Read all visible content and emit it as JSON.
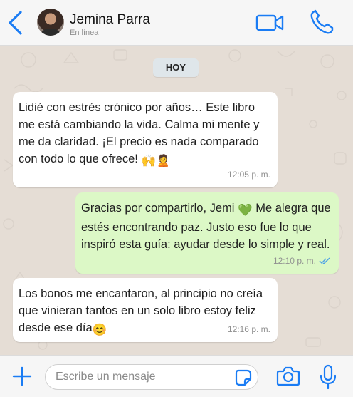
{
  "header": {
    "contact_name": "Jemina Parra",
    "status": "En línea",
    "accent_color": "#1a7cf4"
  },
  "chat": {
    "day_separator": "HOY",
    "messages": [
      {
        "direction": "incoming",
        "text": "Lidié con estrés crónico por años… Este libro me está cambiando la vida. Calma mi mente y me da claridad. ¡El precio es nada comparado con todo lo que ofrece!",
        "emoji": "🙌🙎",
        "time": "12:05 p. m."
      },
      {
        "direction": "outgoing",
        "text_before_emoji": "Gracias por compartirlo, Jemi",
        "emoji": "💚",
        "text_after_emoji": "Me alegra que estés encontrando paz. Justo eso fue lo que inspiró esta guía: ayudar desde lo simple y real.",
        "time": "12:10 p. m.",
        "read_receipt_icon": "double-check-icon"
      },
      {
        "direction": "incoming",
        "text": "Los bonos me encantaron, al principio no creía que vinieran tantos en un solo libro estoy feliz desde ese día",
        "emoji": "😊",
        "time": "12:16 p. m."
      }
    ]
  },
  "composer": {
    "placeholder": "Escribe un mensaje",
    "icons": [
      "plus-icon",
      "sticker-icon",
      "camera-icon",
      "microphone-icon"
    ]
  }
}
